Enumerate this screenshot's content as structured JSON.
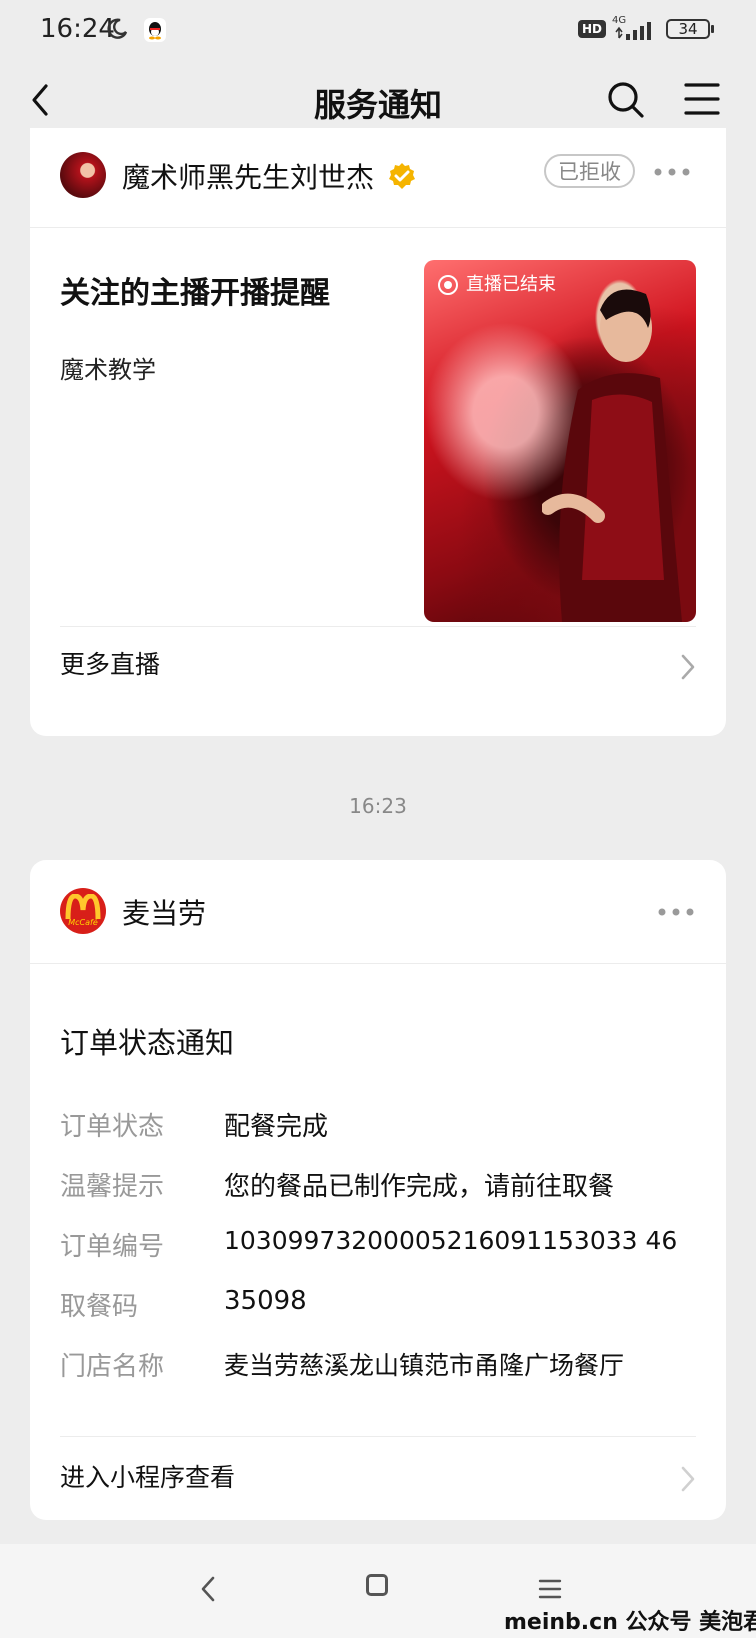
{
  "status_bar": {
    "time": "16:24",
    "hd": "HD",
    "network": "4G",
    "battery": "34"
  },
  "nav": {
    "title": "服务通知",
    "back_icon": "chevron-left-icon",
    "search_icon": "search-icon",
    "menu_icon": "menu-icon"
  },
  "card1": {
    "sender": "魔术师黑先生刘世杰",
    "verified_icon": "verified-check-icon",
    "badge": "已拒收",
    "title": "关注的主播开播提醒",
    "subtitle": "魔术教学",
    "cover_label": "直播已结束",
    "footer": "更多直播"
  },
  "timestamp": "16:23",
  "card2": {
    "sender": "麦当劳",
    "title": "订单状态通知",
    "rows": [
      {
        "label": "订单状态",
        "value": "配餐完成"
      },
      {
        "label": "温馨提示",
        "value": "您的餐品已制作完成，请前往取餐"
      },
      {
        "label": "订单编号",
        "value": "10309973200005216091153033 46"
      },
      {
        "label": "取餐码",
        "value": "35098"
      },
      {
        "label": "门店名称",
        "value": "麦当劳慈溪龙山镇范市甬隆广场餐厅"
      }
    ],
    "footer": "进入小程序查看"
  },
  "watermark": "meinb.cn  公众号 美泡君",
  "colors": {
    "background": "#ededed",
    "card": "#ffffff",
    "verified": "#f5b400",
    "mcd_red": "#d81f19",
    "mcd_yellow": "#ffc72c"
  }
}
